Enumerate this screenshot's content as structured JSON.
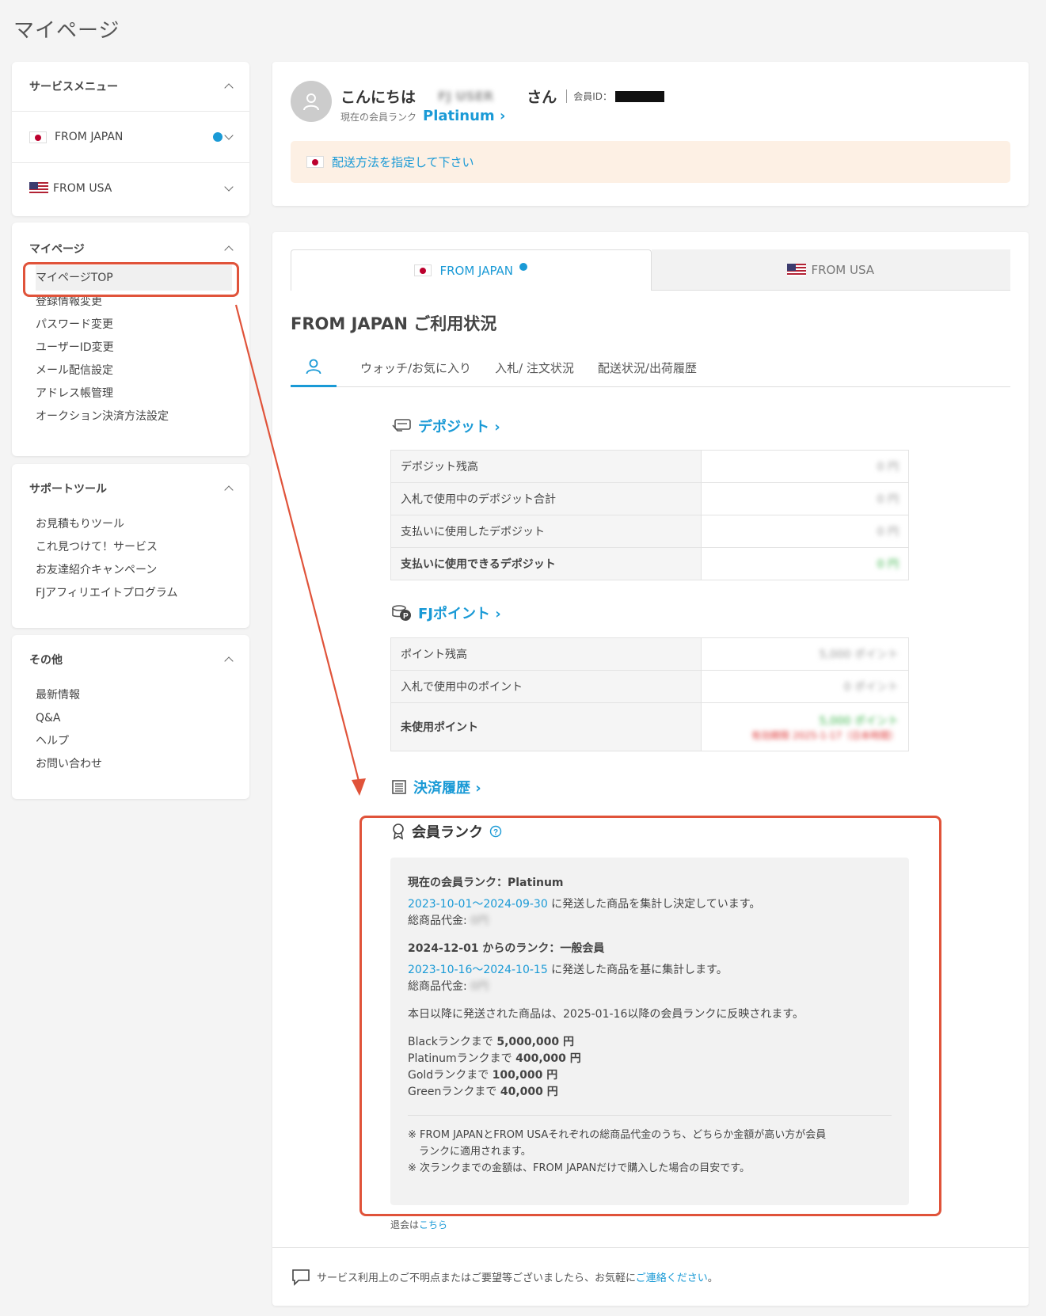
{
  "page_title": "マイページ",
  "sidebar": {
    "service_menu": {
      "title": "サービスメニュー",
      "items": [
        {
          "label": "FROM JAPAN"
        },
        {
          "label": "FROM USA"
        }
      ]
    },
    "mypage": {
      "title": "マイページ",
      "items": [
        "マイページTOP",
        "登録情報変更",
        "パスワード変更",
        "ユーザーID変更",
        "メール配信設定",
        "アドレス帳管理",
        "オークション決済方法設定"
      ]
    },
    "support": {
      "title": "サポートツール",
      "items": [
        "お見積もりツール",
        "これ見つけて！サービス",
        "お友達紹介キャンペーン",
        "FJアフィリエイトプログラム"
      ]
    },
    "other": {
      "title": "その他",
      "items": [
        "最新情報",
        "Q&A",
        "ヘルプ",
        "お問い合わせ"
      ]
    }
  },
  "header_card": {
    "greeting": "こんにちは",
    "user_name": "FJ USER",
    "san": "さん",
    "member_id_label": "会員ID：",
    "rank_label": "現在の会員ランク",
    "rank": "Platinum ›",
    "notice": "配送方法を指定して下さい"
  },
  "tabs": {
    "jp": "FROM JAPAN",
    "us": "FROM USA"
  },
  "status": {
    "title": "FROM JAPAN ご利用状況",
    "sub_tabs": [
      "ウォッチ/お気に入り",
      "入札/ 注文状況",
      "配送状況/出荷履歴"
    ]
  },
  "deposit": {
    "title": "デポジット ›",
    "rows": [
      {
        "label": "デポジット残高",
        "value": "0 円"
      },
      {
        "label": "入札で使用中のデポジット合計",
        "value": "0 円"
      },
      {
        "label": "支払いに使用したデポジット",
        "value": "0 円"
      },
      {
        "label": "支払いに使用できるデポジット",
        "value": "0 円"
      }
    ]
  },
  "points": {
    "title": "FJポイント ›",
    "rows": [
      {
        "label": "ポイント残高",
        "value": "5,000 ポイント"
      },
      {
        "label": "入札で使用中のポイント",
        "value": "0 ポイント"
      },
      {
        "label": "未使用ポイント",
        "value": "5,000 ポイント",
        "expiry": "有効期限 2025-1-17（日本時間）"
      }
    ]
  },
  "payment_history": {
    "title": "決済履歴 ›"
  },
  "member_rank": {
    "title": "会員ランク",
    "current": "現在の会員ランク：Platinum",
    "period1": "2023-10-01〜2024-09-30",
    "period1_text": " に発送した商品を集計し決定しています。",
    "total1": "総商品代金:",
    "total1_value": "0円",
    "next_rank": "2024-12-01 からのランク：一般会員",
    "period2": "2023-10-16〜2024-10-15",
    "period2_text": " に発送した商品を基に集計します。",
    "total2": "総商品代金:",
    "total2_value": "0円",
    "reflect": "本日以降に発送された商品は、2025-01-16以降の会員ランクに反映されます。",
    "thresholds": [
      {
        "label": "Blackランクまで ",
        "value": "5,000,000 円"
      },
      {
        "label": "Platinumランクまで ",
        "value": "400,000 円"
      },
      {
        "label": "Goldランクまで ",
        "value": "100,000 円"
      },
      {
        "label": "Greenランクまで ",
        "value": "40,000 円"
      }
    ],
    "note1": "※ FROM JAPANとFROM USAそれぞれの総商品代金のうち、どちらか金額が高い方が会員",
    "note1b": "ランクに適用されます。",
    "note2": "※ 次ランクまでの金額は、FROM JAPANだけで購入した場合の目安です。"
  },
  "withdraw": {
    "text": "退会は",
    "link": "こちら"
  },
  "footer": {
    "text": "サービス利用上のご不明点またはご要望等ございましたら、お気軽に",
    "link": "ご連絡ください",
    "end": "。"
  },
  "colors": {
    "accent": "#1a9ad6",
    "highlight": "#e0533a",
    "notice_bg": "#fdf0e4"
  }
}
